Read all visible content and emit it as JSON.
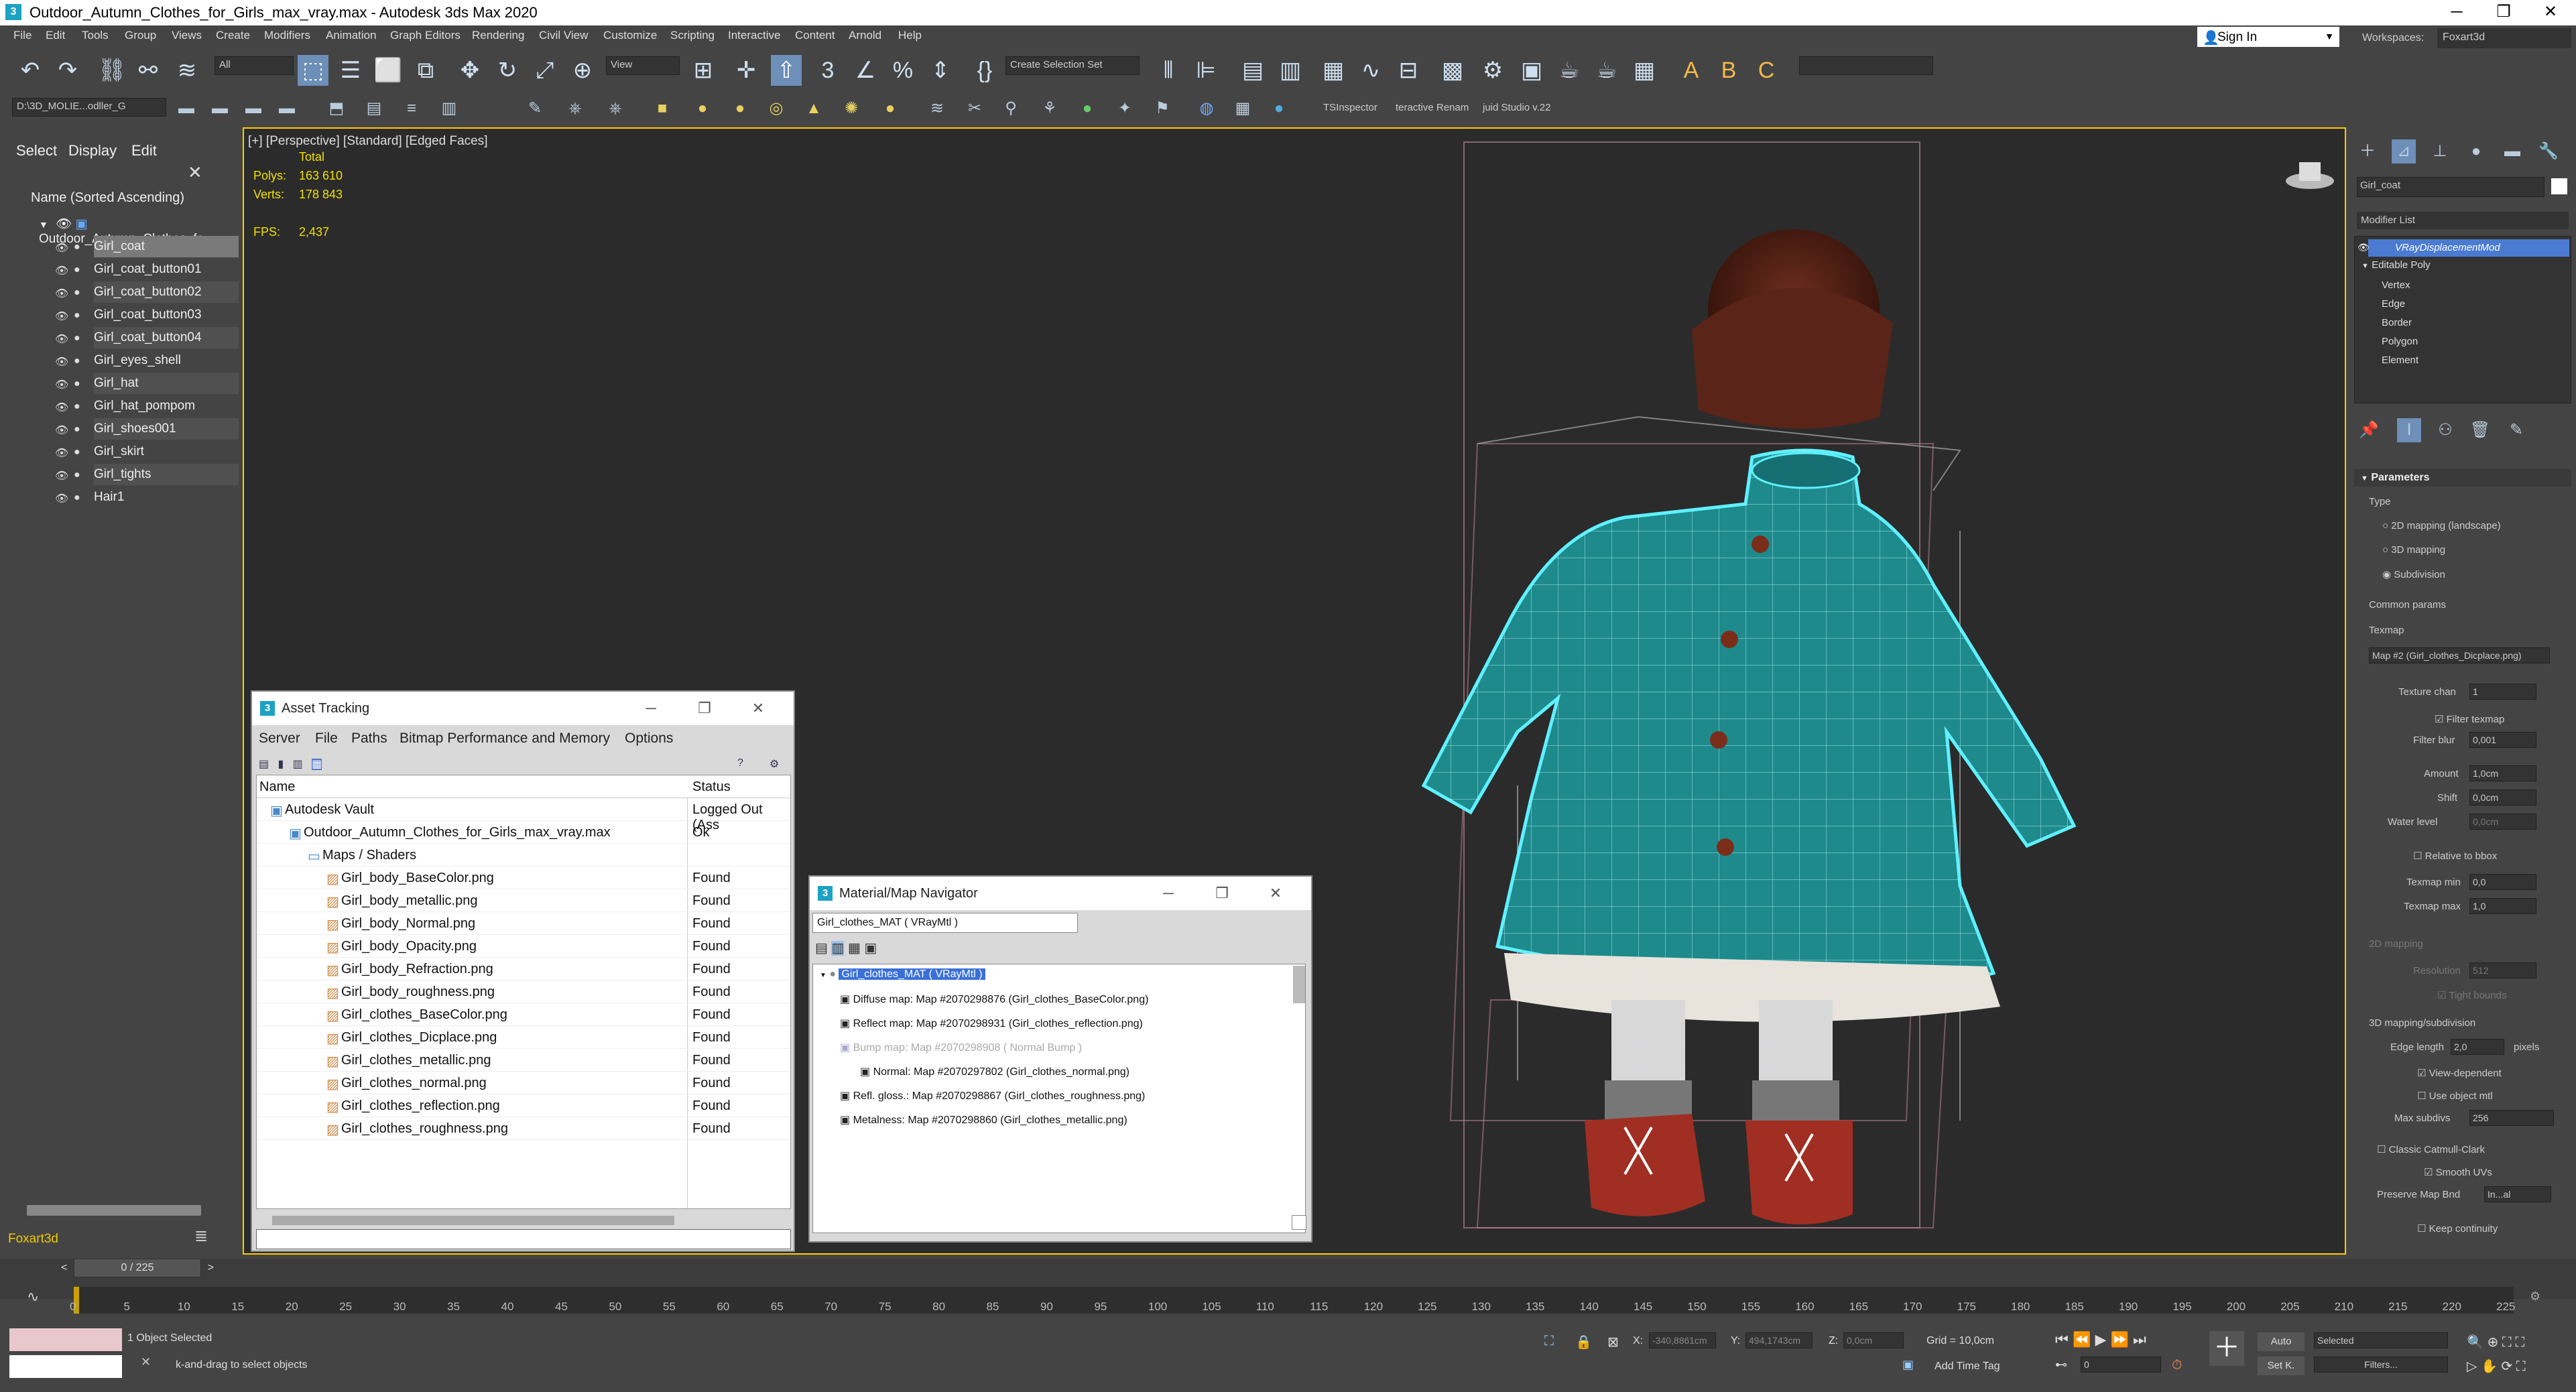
{
  "window": {
    "title": "Outdoor_Autumn_Clothes_for_Girls_max_vray.max - Autodesk 3ds Max 2020",
    "logo_text": "3",
    "minimize": "─",
    "maximize": "❐",
    "close": "✕"
  },
  "menu": [
    "File",
    "Edit",
    "Tools",
    "Group",
    "Views",
    "Create",
    "Modifiers",
    "Animation",
    "Graph Editors",
    "Rendering",
    "Civil View",
    "Customize",
    "Scripting",
    "Interactive",
    "Content",
    "Arnold",
    "Help"
  ],
  "account": {
    "sign_in": "Sign In",
    "workspaces_label": "Workspaces:",
    "workspace": "Foxart3d"
  },
  "toolbar": {
    "selection_filter": "All",
    "view_dropdown": "View",
    "named_selection": "Create Selection Set",
    "project_path": "D:\\3D_MOLIE...odller_G",
    "tsinspector": "TSInspector",
    "interactive_rename": "teractive Renam",
    "studio": "juid Studio v.22"
  },
  "scene_explorer": {
    "tabs": [
      "Select",
      "Display",
      "Edit"
    ],
    "close": "✕",
    "header": "Name (Sorted Ascending)",
    "root": "Outdoor_Autumn_Clothes_fo",
    "items": [
      "Girl_coat",
      "Girl_coat_button01",
      "Girl_coat_button02",
      "Girl_coat_button03",
      "Girl_coat_button04",
      "Girl_eyes_shell",
      "Girl_hat",
      "Girl_hat_pompom",
      "Girl_shoes001",
      "Girl_skirt",
      "Girl_tights",
      "Hair1"
    ],
    "selected_index": 0,
    "layer": "Foxart3d"
  },
  "viewport": {
    "label": "[+] [Perspective] [Standard] [Edged Faces]",
    "total_label": "Total",
    "polys_label": "Polys:",
    "polys": "163 610",
    "verts_label": "Verts:",
    "verts": "178 843",
    "fps_label": "FPS:",
    "fps": "2,437",
    "colors": {
      "coat": "#1e8a8c",
      "wire": "#5ff0ff",
      "hat": "#5a2418",
      "shoes": "#a02e22",
      "skirt": "#e8e4dc",
      "tights": "#d8d8d8",
      "bg": "#2b2b2b"
    }
  },
  "command_panel": {
    "object_name": "Girl_coat",
    "modifier_list": "Modifier List",
    "stack": [
      "VRayDisplacementMod",
      "Editable Poly",
      "Vertex",
      "Edge",
      "Border",
      "Polygon",
      "Element"
    ],
    "parameters_title": "Parameters",
    "type_label": "Type",
    "type_options": [
      "2D mapping (landscape)",
      "3D mapping",
      "Subdivision"
    ],
    "common_params": "Common params",
    "texmap_label": "Texmap",
    "texmap_value": "Map #2 (Girl_clothes_Dicplace.png)",
    "texture_chan_label": "Texture chan",
    "texture_chan": "1",
    "filter_texmap": "Filter texmap",
    "filter_blur_label": "Filter blur",
    "filter_blur": "0,001",
    "amount_label": "Amount",
    "amount": "1,0cm",
    "shift_label": "Shift",
    "shift": "0,0cm",
    "water_level_label": "Water level",
    "water_level": "0,0cm",
    "relative_bbox": "Relative to bbox",
    "texmap_min_label": "Texmap min",
    "texmap_min": "0,0",
    "texmap_max_label": "Texmap max",
    "texmap_max": "1,0",
    "mapping_2d": "2D mapping",
    "resolution_label": "Resolution",
    "resolution": "512",
    "tight_bounds": "Tight bounds",
    "mapping_3d": "3D mapping/subdivision",
    "edge_length_label": "Edge length",
    "edge_length": "2,0",
    "pixels": "pixels",
    "view_dependent": "View-dependent",
    "use_object_mtl": "Use object mtl",
    "max_subdivs_label": "Max subdivs",
    "max_subdivs": "256",
    "classic_catmull": "Classic Catmull-Clark",
    "smooth_uvs": "Smooth UVs",
    "preserve_map_label": "Preserve Map Bnd",
    "preserve_map": "In...al",
    "keep_continuity": "Keep continuity"
  },
  "asset_tracking": {
    "title": "Asset Tracking",
    "menu": [
      "Server",
      "File",
      "Paths",
      "Bitmap Performance and Memory",
      "Options"
    ],
    "col_name": "Name",
    "col_status": "Status",
    "rows": [
      {
        "name": "Autodesk Vault",
        "status": "Logged Out (Ass",
        "indent": 0
      },
      {
        "name": "Outdoor_Autumn_Clothes_for_Girls_max_vray.max",
        "status": "Ok",
        "indent": 1
      },
      {
        "name": "Maps / Shaders",
        "status": "",
        "indent": 2
      },
      {
        "name": "Girl_body_BaseColor.png",
        "status": "Found",
        "indent": 3
      },
      {
        "name": "Girl_body_metallic.png",
        "status": "Found",
        "indent": 3
      },
      {
        "name": "Girl_body_Normal.png",
        "status": "Found",
        "indent": 3
      },
      {
        "name": "Girl_body_Opacity.png",
        "status": "Found",
        "indent": 3
      },
      {
        "name": "Girl_body_Refraction.png",
        "status": "Found",
        "indent": 3
      },
      {
        "name": "Girl_body_roughness.png",
        "status": "Found",
        "indent": 3
      },
      {
        "name": "Girl_clothes_BaseColor.png",
        "status": "Found",
        "indent": 3
      },
      {
        "name": "Girl_clothes_Dicplace.png",
        "status": "Found",
        "indent": 3
      },
      {
        "name": "Girl_clothes_metallic.png",
        "status": "Found",
        "indent": 3
      },
      {
        "name": "Girl_clothes_normal.png",
        "status": "Found",
        "indent": 3
      },
      {
        "name": "Girl_clothes_reflection.png",
        "status": "Found",
        "indent": 3
      },
      {
        "name": "Girl_clothes_roughness.png",
        "status": "Found",
        "indent": 3
      }
    ]
  },
  "material_navigator": {
    "title": "Material/Map Navigator",
    "current": "Girl_clothes_MAT  ( VRayMtl )",
    "root": "Girl_clothes_MAT  ( VRayMtl )",
    "maps": [
      "Diffuse map: Map #2070298876 (Girl_clothes_BaseColor.png)",
      "Reflect map: Map #2070298931 (Girl_clothes_reflection.png)",
      "Bump map: Map #2070298908  ( Normal Bump )",
      "Normal: Map #2070297802 (Girl_clothes_normal.png)",
      "Refl. gloss.: Map #2070298867 (Girl_clothes_roughness.png)",
      "Metalness: Map #2070298860 (Girl_clothes_metallic.png)"
    ]
  },
  "timeline": {
    "frame_counter": "0 / 225",
    "ticks": [
      "0",
      "5",
      "10",
      "15",
      "20",
      "25",
      "30",
      "35",
      "40",
      "45",
      "50",
      "55",
      "60",
      "65",
      "70",
      "75",
      "80",
      "85",
      "90",
      "95",
      "100",
      "105",
      "110",
      "115",
      "120",
      "125",
      "130",
      "135",
      "140",
      "145",
      "150",
      "155",
      "160",
      "165",
      "170",
      "175",
      "180",
      "185",
      "190",
      "195",
      "200",
      "205",
      "210",
      "215",
      "220",
      "225"
    ]
  },
  "status": {
    "selection": "1 Object Selected",
    "prompt": "k-and-drag to select objects",
    "x_label": "X:",
    "x": "-340,8861cm",
    "y_label": "Y:",
    "y": "494,1743cm",
    "z_label": "Z:",
    "z": "0,0cm",
    "grid": "Grid = 10,0cm",
    "add_time_tag": "Add Time Tag",
    "auto": "Auto",
    "set_key": "Set K.",
    "selected_dropdown": "Selected",
    "filters": "Filters...",
    "frame": "0"
  }
}
